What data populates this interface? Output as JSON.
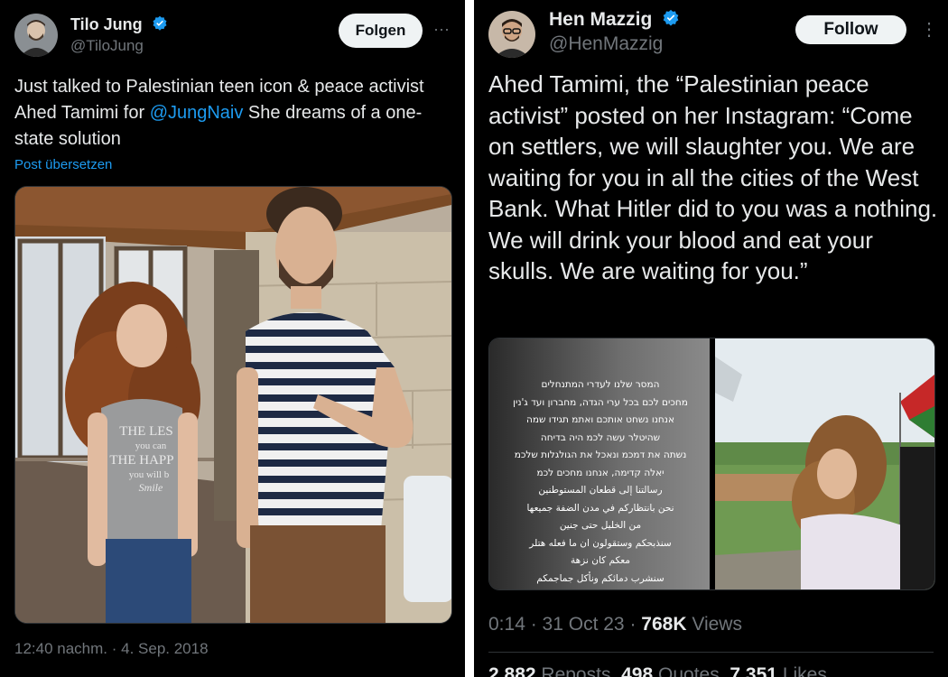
{
  "left_tweet": {
    "author_name": "Tilo Jung",
    "author_handle": "@TiloJung",
    "follow_label": "Folgen",
    "more_label": "···",
    "text_before": "Just talked to Palestinian teen icon & peace activist Ahed Tamimi for ",
    "mention": "@JungNaiv",
    "text_after": " She dreams of a one-state solution",
    "translate_label": "Post übersetzen",
    "timestamp": "12:40 nachm. · 4. Sep. 2018",
    "photo": {
      "shirt_text": [
        "THE LES",
        "you can",
        "THE HAPP",
        "you will b",
        "Smile"
      ]
    }
  },
  "right_tweet": {
    "author_name": "Hen Mazzig",
    "author_handle": "@HenMazzig",
    "follow_label": "Follow",
    "more_label": "⋮",
    "text": "Ahed Tamimi, the “Palestinian peace activist” posted on her Instagram: “Come on settlers, we will slaughter you. We are waiting for you in all the cities of the West Bank. What Hitler did to you was a nothing. We will drink your blood and eat your skulls. We are waiting for you.”",
    "time": "0:14",
    "date": "31 Oct 23",
    "views_count": "768K",
    "views_label": "Views",
    "reposts_count": "2,882",
    "reposts_label": "Reposts",
    "quotes_count": "498",
    "quotes_label": "Quotes",
    "likes_count": "7,351",
    "likes_label": "Likes",
    "story_lines": [
      "המסר שלנו לעדרי המתנחלים",
      "מחכים לכם בכל ערי הגדה, מחברון ועד ג'נין",
      "אנחנו נשחט אותכם ואתמ תגידו שמה",
      "שהיטלר עשה לכמ היה בדיחה",
      "נשתה את דמכמ ונאכל את הגולגלות שלכמ",
      "יאלה קדימה, אנחנו מחכים לכמ",
      "رسالتنا إلى قطعان المستوطنين",
      "نحن بانتظاركم في مدن الضفة جميعها",
      "من الخليل حتى جنين",
      "سنذبحكم وستقولون ان ما فعله هتلر",
      "معكم كان نزهة",
      "سنشرب دمائكم ونأكل جماجمكم"
    ]
  },
  "colors": {
    "background": "#000000",
    "text": "#e7e9ea",
    "muted": "#71767b",
    "accent": "#1d9bf0",
    "verified": "#1d9bf0"
  }
}
